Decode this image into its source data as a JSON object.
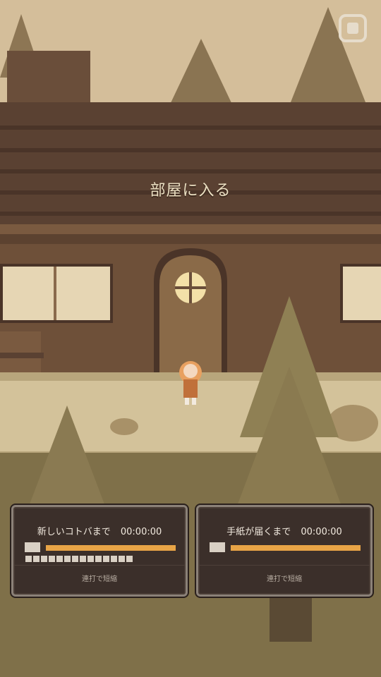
{
  "scene": {
    "enter_room_label": "部屋に入る",
    "settings_icon": "gear-icon",
    "colors": {
      "sky": "#d7c09c",
      "wall": "#5a4132",
      "bar": "#e8a446",
      "panel_bg": "#3b2f2a"
    }
  },
  "panels": {
    "words": {
      "title": "新しいコトバまで",
      "timer": "00:00:00",
      "icon": "card-icon",
      "hint": "連打で短縮"
    },
    "letter": {
      "title": "手紙が届くまで",
      "timer": "00:00:00",
      "icon": "envelope-icon",
      "hint": "連打で短縮"
    }
  }
}
